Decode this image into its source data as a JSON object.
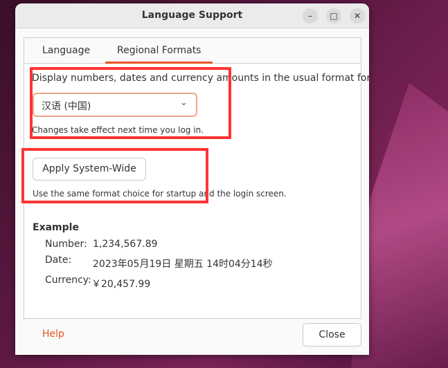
{
  "window": {
    "title": "Language Support"
  },
  "tabs": [
    {
      "label": "Language"
    },
    {
      "label": "Regional Formats",
      "active": true
    }
  ],
  "regional": {
    "prompt": "Display numbers, dates and currency amounts in the usual format for:",
    "format_value": "汉语 (中国)",
    "note": "Changes take effect next time you log in.",
    "apply_label": "Apply System-Wide",
    "apply_note": "Use the same format choice for startup and the login screen."
  },
  "example": {
    "heading": "Example",
    "number_label": "Number:",
    "number_value": "1,234,567.89",
    "date_label": "Date:",
    "date_value": "2023年05月19日 星期五 14时04分14秒",
    "currency_label": "Currency:",
    "currency_value": "￥20,457.99"
  },
  "footer": {
    "help_label": "Help",
    "close_label": "Close"
  },
  "colors": {
    "accent": "#e95420",
    "annotation": "#ff3333"
  }
}
